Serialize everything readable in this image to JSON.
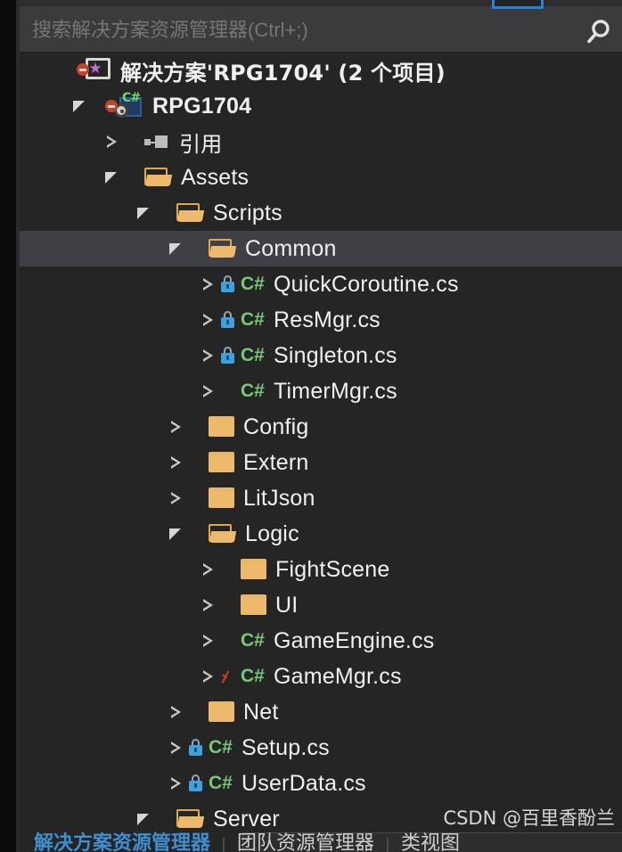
{
  "search": {
    "placeholder": "搜索解决方案资源管理器(Ctrl+;)",
    "value": "",
    "icon": "search-icon"
  },
  "colors": {
    "panel_bg": "#252526",
    "searchbar_bg": "#3b3b3d",
    "selection": "#3f3f46",
    "folder": "#edb96d",
    "csharp": "#77c877",
    "lock": "#3fa0dc",
    "pending_check": "#cf3b24",
    "active_tab": "#3f8fd0",
    "text": "#f0f0f0"
  },
  "tree": {
    "rows": [
      {
        "label": "解决方案'RPG1704' (2 个项目)",
        "depth": 0,
        "expander": "none",
        "icon": "solution-icon",
        "badge": "none",
        "bold": true,
        "zh": true,
        "selected": false
      },
      {
        "label": "RPG1704",
        "depth": 1,
        "expander": "expanded",
        "icon": "project-icon",
        "badge": "none",
        "bold": true,
        "zh": false,
        "selected": false
      },
      {
        "label": "引用",
        "depth": 2,
        "expander": "collapsed",
        "icon": "references-icon",
        "badge": "none",
        "bold": false,
        "zh": true,
        "selected": false
      },
      {
        "label": "Assets",
        "depth": 2,
        "expander": "expanded",
        "icon": "folder-open-icon",
        "badge": "none",
        "bold": false,
        "zh": false,
        "selected": false
      },
      {
        "label": "Scripts",
        "depth": 3,
        "expander": "expanded",
        "icon": "folder-open-icon",
        "badge": "none",
        "bold": false,
        "zh": false,
        "selected": false
      },
      {
        "label": "Common",
        "depth": 4,
        "expander": "expanded",
        "icon": "folder-open-icon",
        "badge": "none",
        "bold": false,
        "zh": false,
        "selected": true
      },
      {
        "label": "QuickCoroutine.cs",
        "depth": 5,
        "expander": "collapsed",
        "icon": "csharp-file-icon",
        "badge": "lock",
        "bold": false,
        "zh": false,
        "selected": false
      },
      {
        "label": "ResMgr.cs",
        "depth": 5,
        "expander": "collapsed",
        "icon": "csharp-file-icon",
        "badge": "lock",
        "bold": false,
        "zh": false,
        "selected": false
      },
      {
        "label": "Singleton.cs",
        "depth": 5,
        "expander": "collapsed",
        "icon": "csharp-file-icon",
        "badge": "lock",
        "bold": false,
        "zh": false,
        "selected": false
      },
      {
        "label": "TimerMgr.cs",
        "depth": 5,
        "expander": "collapsed",
        "icon": "csharp-file-icon",
        "badge": "none",
        "bold": false,
        "zh": false,
        "selected": false
      },
      {
        "label": "Config",
        "depth": 4,
        "expander": "collapsed",
        "icon": "folder-icon",
        "badge": "none",
        "bold": false,
        "zh": false,
        "selected": false
      },
      {
        "label": "Extern",
        "depth": 4,
        "expander": "collapsed",
        "icon": "folder-icon",
        "badge": "none",
        "bold": false,
        "zh": false,
        "selected": false
      },
      {
        "label": "LitJson",
        "depth": 4,
        "expander": "collapsed",
        "icon": "folder-icon",
        "badge": "none",
        "bold": false,
        "zh": false,
        "selected": false
      },
      {
        "label": "Logic",
        "depth": 4,
        "expander": "expanded",
        "icon": "folder-open-icon",
        "badge": "none",
        "bold": false,
        "zh": false,
        "selected": false
      },
      {
        "label": "FightScene",
        "depth": 5,
        "expander": "collapsed",
        "icon": "folder-icon",
        "badge": "none",
        "bold": false,
        "zh": false,
        "selected": false
      },
      {
        "label": "UI",
        "depth": 5,
        "expander": "collapsed",
        "icon": "folder-icon",
        "badge": "none",
        "bold": false,
        "zh": false,
        "selected": false
      },
      {
        "label": "GameEngine.cs",
        "depth": 5,
        "expander": "collapsed",
        "icon": "csharp-file-icon",
        "badge": "none",
        "bold": false,
        "zh": false,
        "selected": false
      },
      {
        "label": "GameMgr.cs",
        "depth": 5,
        "expander": "collapsed",
        "icon": "csharp-file-icon",
        "badge": "check",
        "bold": false,
        "zh": false,
        "selected": false
      },
      {
        "label": "Net",
        "depth": 4,
        "expander": "collapsed",
        "icon": "folder-icon",
        "badge": "none",
        "bold": false,
        "zh": false,
        "selected": false
      },
      {
        "label": "Setup.cs",
        "depth": 4,
        "expander": "collapsed",
        "icon": "csharp-file-icon",
        "badge": "lock",
        "bold": false,
        "zh": false,
        "selected": false
      },
      {
        "label": "UserData.cs",
        "depth": 4,
        "expander": "collapsed",
        "icon": "csharp-file-icon",
        "badge": "lock",
        "bold": false,
        "zh": false,
        "selected": false
      },
      {
        "label": "Server",
        "depth": 3,
        "expander": "expanded",
        "icon": "folder-open-icon",
        "badge": "none",
        "bold": false,
        "zh": false,
        "selected": false
      }
    ]
  },
  "bottom_tabs": [
    {
      "label": "解决方案资源管理器",
      "active": true
    },
    {
      "label": "团队资源管理器",
      "active": false
    },
    {
      "label": "类视图",
      "active": false
    }
  ],
  "watermark": "CSDN @百里香酚兰"
}
